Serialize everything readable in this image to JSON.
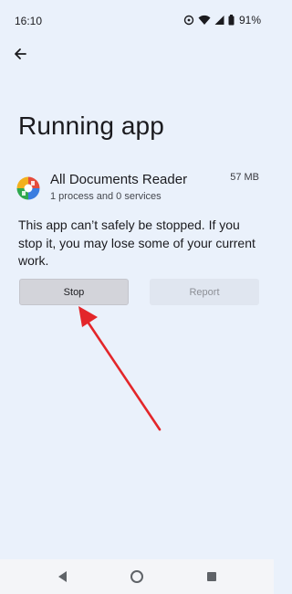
{
  "status_bar": {
    "time": "16:10",
    "battery_percent": "91%",
    "icons": [
      "sync-icon",
      "wifi-icon",
      "signal-icon",
      "battery-icon"
    ]
  },
  "header": {
    "back_icon": "arrow-back-icon",
    "title": "Running app"
  },
  "app": {
    "icon": "all-documents-reader-icon",
    "name": "All Documents Reader",
    "size": "57 MB",
    "subtitle": "1 process and 0 services"
  },
  "message": "This app can’t safely be stopped. If you stop it, you may lose some of your current work.",
  "actions": {
    "stop_label": "Stop",
    "report_label": "Report",
    "report_enabled": false
  },
  "annotation": {
    "type": "arrow",
    "color": "#e3262a",
    "points_to": "stop-button"
  },
  "navigation": {
    "icons": [
      "nav-back-icon",
      "nav-home-icon",
      "nav-recents-icon"
    ]
  },
  "colors": {
    "background": "#eaf1fb",
    "stop_button": "#d3d4da",
    "report_button": "#e0e6f0",
    "arrow": "#e3262a"
  }
}
